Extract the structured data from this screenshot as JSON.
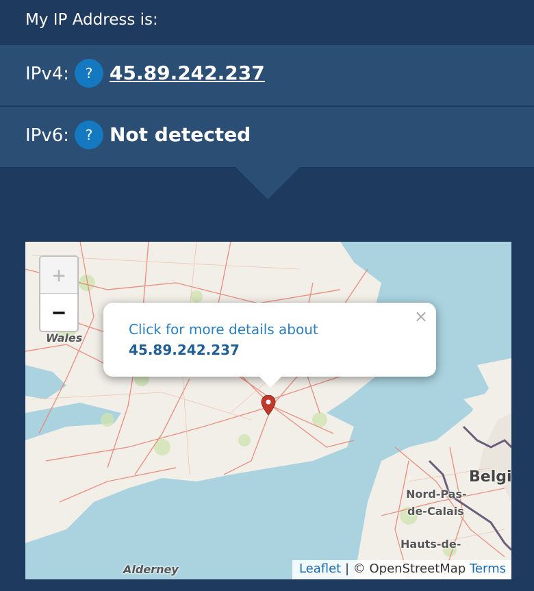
{
  "header": {
    "title": "My IP Address is:"
  },
  "ipv4": {
    "label": "IPv4:",
    "help": "?",
    "value": "45.89.242.237"
  },
  "ipv6": {
    "label": "IPv6:",
    "help": "?",
    "value": "Not detected"
  },
  "map": {
    "zoom_in": "+",
    "zoom_out": "−",
    "popup": {
      "close": "×",
      "line1": "Click for more details about",
      "line2": "45.89.242.237"
    },
    "places": {
      "wales": "Wales",
      "alderney": "Alderney",
      "belgium": "Belgi",
      "nord_pas": "Nord-Pas-",
      "de_calais": "de-Calais",
      "hauts_de": "Hauts-de-"
    },
    "attribution": {
      "leaflet": "Leaflet",
      "separator": " | © ",
      "osm": "OpenStreetMap",
      "terms": "Terms"
    },
    "colors": {
      "land": "#f2efe9",
      "sea": "#aad3df",
      "roads": "#e88a7a",
      "marker": "#c0392b"
    }
  }
}
